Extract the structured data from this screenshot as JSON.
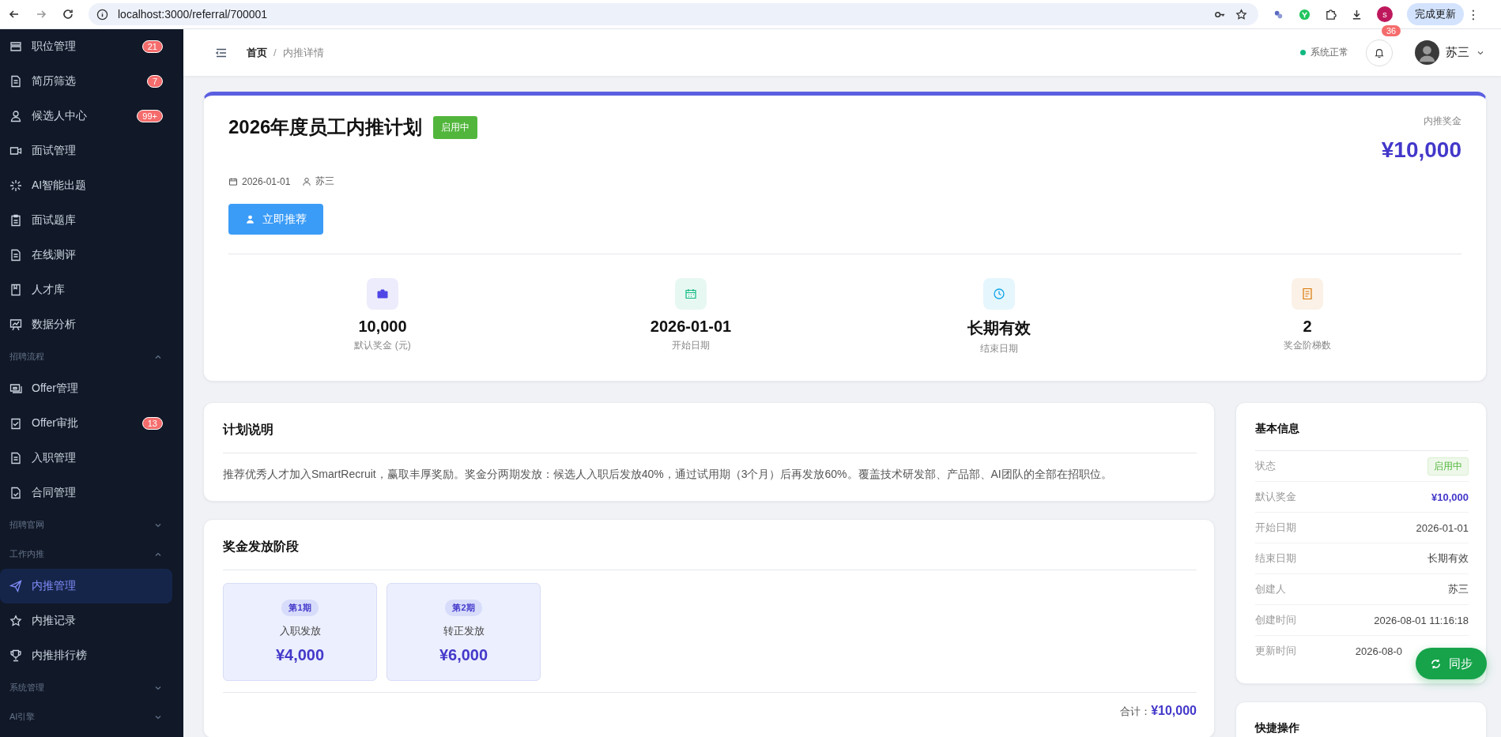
{
  "browser": {
    "url": "localhost:3000/referral/700001",
    "profile_initial": "s",
    "update_button": "完成更新",
    "menu_glyph": "⋮"
  },
  "sidebar": {
    "entries": [
      {
        "kind": "item",
        "label": "职位管理",
        "badge": "21",
        "selected": false
      },
      {
        "kind": "item",
        "label": "简历筛选",
        "badge": "7",
        "selected": false
      },
      {
        "kind": "item",
        "label": "候选人中心",
        "badge": "99+",
        "selected": false
      },
      {
        "kind": "item",
        "label": "面试管理",
        "selected": false
      },
      {
        "kind": "item",
        "label": "AI智能出题",
        "selected": false
      },
      {
        "kind": "item",
        "label": "面试题库",
        "selected": false
      },
      {
        "kind": "item",
        "label": "在线测评",
        "selected": false
      },
      {
        "kind": "item",
        "label": "人才库",
        "selected": false
      },
      {
        "kind": "item",
        "label": "数据分析",
        "selected": false
      },
      {
        "kind": "group",
        "label": "招聘流程",
        "expanded": true,
        "children": [
          {
            "label": "Offer管理",
            "selected": false
          },
          {
            "label": "Offer审批",
            "badge": "13",
            "selected": false
          },
          {
            "label": "入职管理",
            "selected": false
          },
          {
            "label": "合同管理",
            "selected": false
          }
        ]
      },
      {
        "kind": "group",
        "label": "招聘官网",
        "expanded": false
      },
      {
        "kind": "group",
        "label": "工作内推",
        "expanded": true,
        "children": [
          {
            "label": "内推管理",
            "selected": true
          },
          {
            "label": "内推记录",
            "selected": false
          },
          {
            "label": "内推排行榜",
            "selected": false
          }
        ]
      },
      {
        "kind": "group",
        "label": "系统管理",
        "expanded": false
      },
      {
        "kind": "group",
        "label": "AI引擎",
        "expanded": false
      }
    ]
  },
  "header": {
    "breadcrumb": [
      {
        "label": "首页",
        "current": false
      },
      {
        "label": "内推详情",
        "current": true
      }
    ],
    "separator": "/",
    "system_status": {
      "label": "系统正常",
      "color": "#10b981"
    },
    "notifications": "36",
    "user": "苏三"
  },
  "plan": {
    "title": "2026年度员工内推计划",
    "status": {
      "label": "启用中",
      "kind": "success"
    },
    "bonus_label": "内推奖金",
    "bonus": "¥10,000",
    "date": "2026-01-01",
    "creator": "苏三",
    "recommend_button": "立即推荐",
    "stats": [
      {
        "value": "10,000",
        "label": "默认奖金 (元)",
        "color": "#4f46e5"
      },
      {
        "value": "2026-01-01",
        "label": "开始日期",
        "color": "#10b981"
      },
      {
        "value": "长期有效",
        "label": "结束日期",
        "color": "#0ea5e9"
      },
      {
        "value": "2",
        "label": "奖金阶梯数",
        "color": "#d97706"
      }
    ]
  },
  "description": {
    "title": "计划说明",
    "text": "推荐优秀人才加入SmartRecruit，赢取丰厚奖励。奖金分两期发放：候选人入职后发放40%，通过试用期（3个月）后再发放60%。覆盖技术研发部、产品部、AI团队的全部在招职位。"
  },
  "stages": {
    "title": "奖金发放阶段",
    "items": [
      {
        "badge": "第1期",
        "name": "入职发放",
        "amount": "¥4,000"
      },
      {
        "badge": "第2期",
        "name": "转正发放",
        "amount": "¥6,000"
      }
    ],
    "total_label": "合计：",
    "total": "¥10,000"
  },
  "basic_info": {
    "title": "基本信息",
    "rows": [
      {
        "label": "状态",
        "value": "启用中",
        "kind": "tag"
      },
      {
        "label": "默认奖金",
        "value": "¥10,000",
        "kind": "amount"
      },
      {
        "label": "开始日期",
        "value": "2026-01-01",
        "kind": "text"
      },
      {
        "label": "结束日期",
        "value": "长期有效",
        "kind": "text"
      },
      {
        "label": "创建人",
        "value": "苏三",
        "kind": "text"
      },
      {
        "label": "创建时间",
        "value": "2026-08-01 11:16:18",
        "kind": "text"
      },
      {
        "label": "更新时间",
        "value": "2026-08-0",
        "kind": "text"
      }
    ]
  },
  "quick_actions": {
    "title": "快捷操作"
  },
  "sync_button": "同步"
}
